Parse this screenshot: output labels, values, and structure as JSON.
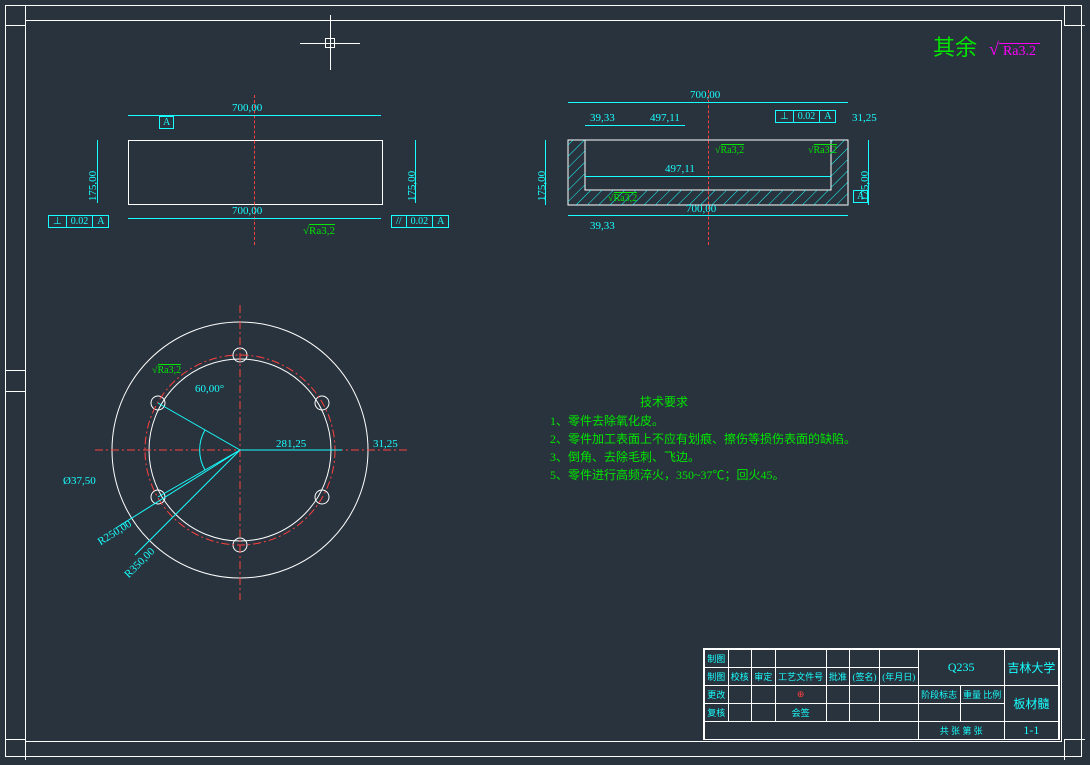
{
  "global_surface": {
    "label": "其余",
    "roughness": "Ra3.2"
  },
  "front_view": {
    "dims": {
      "width_top": "700,00",
      "width_bot": "700,00",
      "height_l": "175,00",
      "height_r": "175,00"
    },
    "datum": "A",
    "gdt_perp": {
      "sym": "⊥",
      "tol": "0.02",
      "ref": "A"
    },
    "gdt_par": {
      "sym": "//",
      "tol": "0.02",
      "ref": "A"
    },
    "ra_bot": "Ra3,2"
  },
  "section_view": {
    "dims": {
      "width_out": "700,00",
      "width_in1": "497,11",
      "width_in2": "497,11",
      "wall_l": "39,33",
      "wall_l2": "39,33",
      "wall_r": "31,25",
      "height_l": "175,00",
      "height_r": "175,00",
      "width_bot": "700,00"
    },
    "gdt": {
      "sym": "⊥",
      "tol": "0.02",
      "ref": "A"
    },
    "datum": "A",
    "ra1": "Ra3,2",
    "ra2": "Ra3,2",
    "ra3": "Ra3,2"
  },
  "top_view": {
    "r_out": "R350,00",
    "r_in": "R250,00",
    "hole_d": "Ø37,50",
    "angle": "60,00°",
    "pcd": "281,25",
    "edge": "31,25",
    "ra": "Ra3,2"
  },
  "notes": {
    "title": "技术要求",
    "l1": "1、零件去除氧化皮。",
    "l2": "2、零件加工表面上不应有划痕、擦伤等损伤表面的缺陷。",
    "l3": "3、倒角、去除毛刺、飞边。",
    "l4": "5、零件进行高频淬火，350~37℃；回火45。"
  },
  "titleblock": {
    "mat": "Q235",
    "inst": "吉林大学",
    "part": "板材髓",
    "sheet": "1-1",
    "row1": [
      "制图",
      "校核",
      "审定",
      "工艺文件号",
      "批准",
      "(签名)",
      "(年月日)"
    ],
    "row2": [
      "更改",
      "",
      "",
      "",
      "",
      "",
      ""
    ],
    "row3": [
      "复核",
      "",
      "",
      "会签",
      "",
      "",
      ""
    ],
    "col2": {
      "a": "阶段标志",
      "b": "重量",
      "c": "比例"
    },
    "bot": [
      "共",
      "张",
      "第",
      "张"
    ]
  }
}
